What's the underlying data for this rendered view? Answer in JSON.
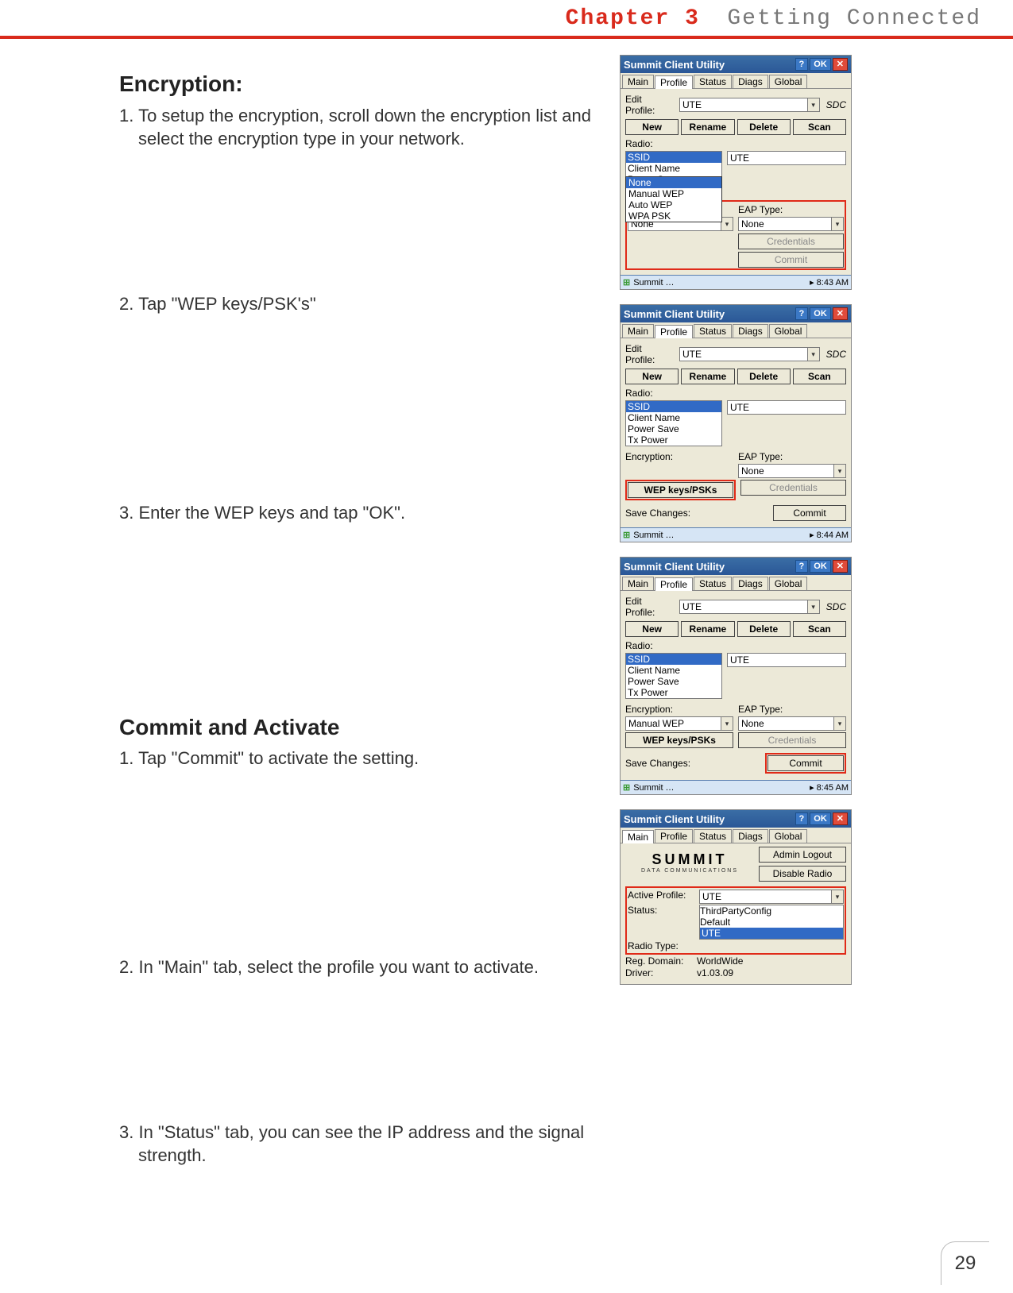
{
  "header": {
    "chapter": "Chapter 3",
    "title": "Getting Connected"
  },
  "page_number": "29",
  "sections": {
    "s1": {
      "heading": "Encryption:",
      "step1": "1. To setup the encryption, scroll down the encryption list and select the encryption type in your network.",
      "step2": "2. Tap \"WEP keys/PSK's\"",
      "step3": "3. Enter the WEP keys and tap \"OK\"."
    },
    "s2": {
      "heading": "Commit and Activate",
      "step1": "1. Tap \"Commit\" to activate the setting.",
      "step2": "2. In \"Main\" tab, select the profile you want to activate.",
      "step3": "3. In \"Status\" tab, you can see the IP address and the signal strength."
    }
  },
  "ui": {
    "window_title": "Summit Client Utility",
    "help": "?",
    "ok": "OK",
    "close": "✕",
    "tabs": {
      "main": "Main",
      "profile": "Profile",
      "status": "Status",
      "diags": "Diags",
      "global": "Global"
    },
    "edit_profile_label": "Edit\nProfile:",
    "edit_profile_value": "UTE",
    "sdc": "SDC",
    "buttons": {
      "new": "New",
      "rename": "Rename",
      "delete": "Delete",
      "scan": "Scan"
    },
    "radio_label": "Radio:",
    "list": {
      "ssid": "SSID",
      "client_name": "Client Name",
      "power_save": "Power Save",
      "tx_power": "Tx Power"
    },
    "ssid_value": "UTE",
    "encryption_label": "Encryption:",
    "encryption_value": "None",
    "encryption_value2": "Manual WEP",
    "eap_label": "EAP Type:",
    "eap_value": "None",
    "dropdown": {
      "none": "None",
      "manual_wep": "Manual WEP",
      "auto_wep": "Auto WEP",
      "wpa_psk": "WPA PSK"
    },
    "wep_button": "WEP keys/PSKs",
    "credentials": "Credentials",
    "commit": "Commit",
    "save_changes": "Save Changes:",
    "taskbar": {
      "start": "Summit …",
      "time1": "8:43 AM",
      "time2": "8:44 AM",
      "time3": "8:45 AM"
    },
    "admin_logout": "Admin Logout",
    "disable_radio": "Disable Radio",
    "summit_logo": "SUMMIT",
    "summit_sub": "DATA COMMUNICATIONS",
    "main": {
      "active_profile": "Active Profile:",
      "active_value": "UTE",
      "status": "Status:",
      "status_value": "ThirdPartyConfig",
      "radio_type": "Radio Type:",
      "default": "Default",
      "ute": "UTE",
      "reg_domain": "Reg. Domain:",
      "reg_value": "WorldWide",
      "driver": "Driver:",
      "driver_value": "v1.03.09"
    }
  }
}
